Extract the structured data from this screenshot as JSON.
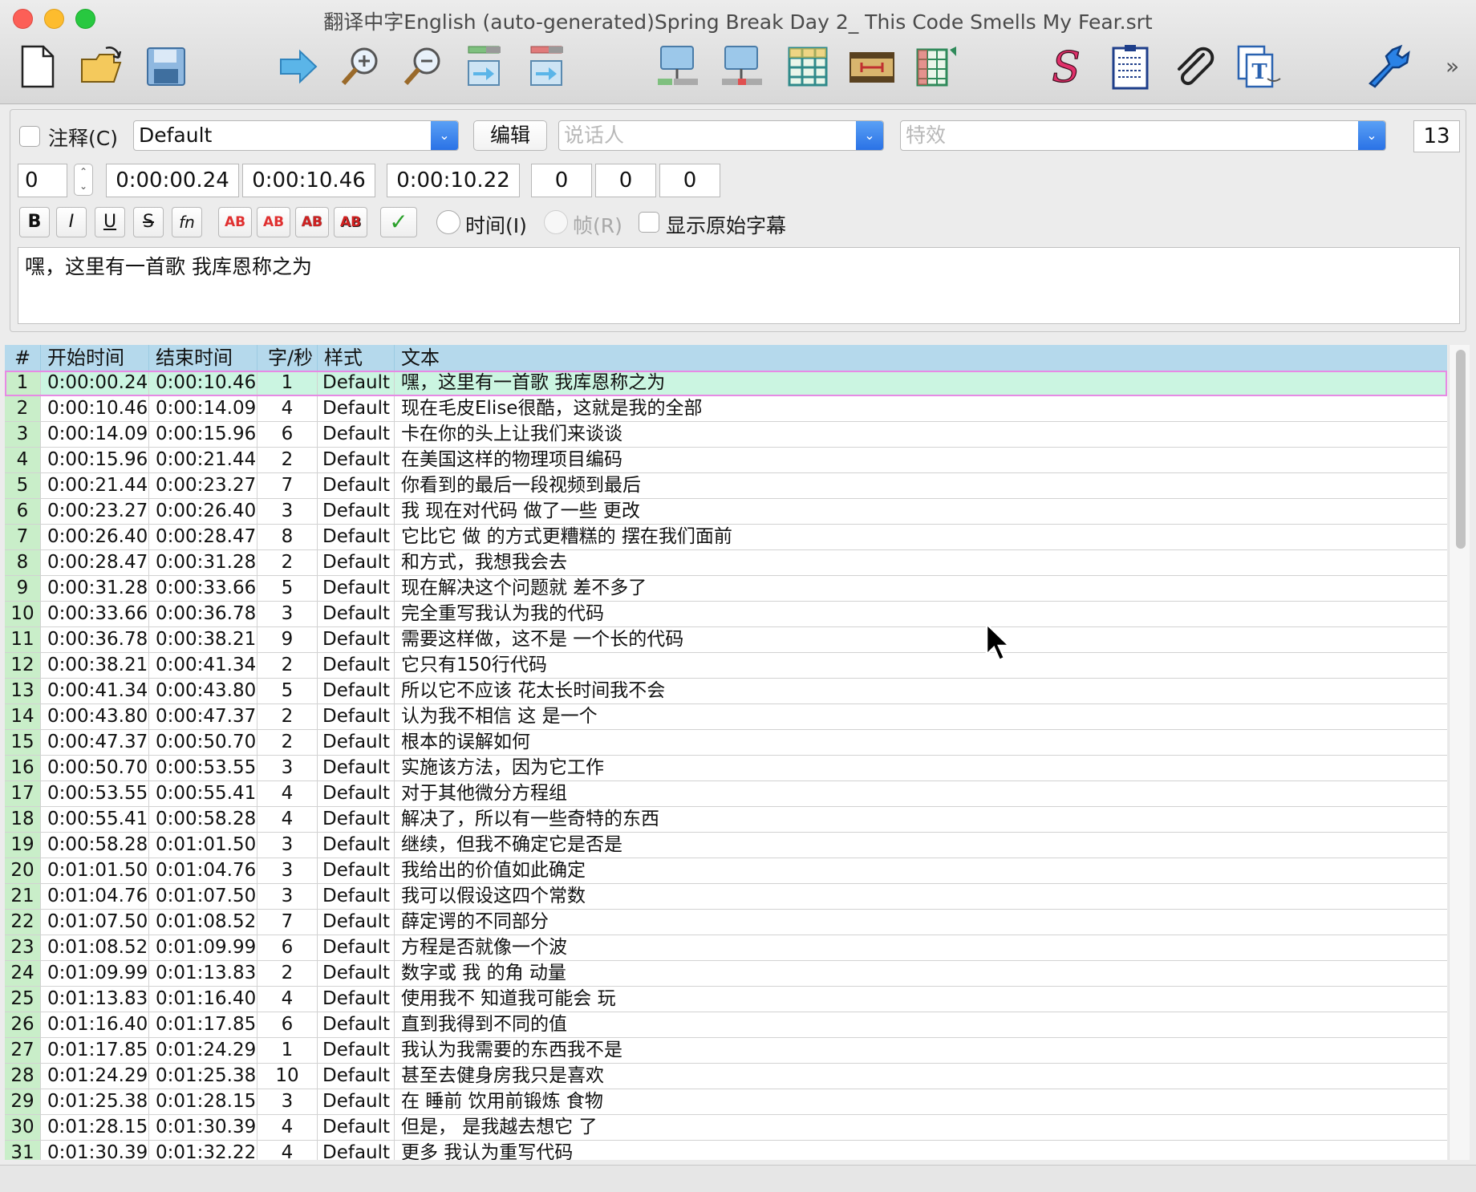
{
  "window": {
    "title": "翻译中字English (auto-generated)Spring Break Day 2_ This Code Smells My Fear.srt"
  },
  "toolbar": {
    "buttons": [
      {
        "name": "new-file"
      },
      {
        "name": "open-file"
      },
      {
        "name": "save"
      },
      {
        "name": "forward-arrow"
      },
      {
        "name": "zoom-in"
      },
      {
        "name": "zoom-out"
      },
      {
        "name": "move-down"
      },
      {
        "name": "move-up"
      },
      {
        "name": "insert-before"
      },
      {
        "name": "insert-after"
      },
      {
        "name": "table-view"
      },
      {
        "name": "film-strip"
      },
      {
        "name": "grid-edit"
      },
      {
        "name": "spell-check"
      },
      {
        "name": "clipboard"
      },
      {
        "name": "attachment"
      },
      {
        "name": "translate"
      },
      {
        "name": "settings-gear"
      }
    ],
    "more": "»"
  },
  "editor": {
    "comment_label": "注释(C)",
    "style_value": "Default",
    "edit_button": "编辑",
    "speaker_placeholder": "说话人",
    "effect_placeholder": "特效",
    "layer_value": "13",
    "line_index": "0",
    "start_time": "0:00:00.24",
    "end_time": "0:00:10.46",
    "duration": "0:00:10.22",
    "margin_l": "0",
    "margin_r": "0",
    "margin_v": "0",
    "format_buttons": [
      "B",
      "I",
      "U",
      "S",
      "fn",
      "AB",
      "AB",
      "AB",
      "AB",
      "✓"
    ],
    "time_radio": "时间(I)",
    "frame_radio": "帧(R)",
    "show_original": "显示原始字幕",
    "text": "嘿，这里有一首歌 我库恩称之为"
  },
  "grid": {
    "headers": [
      "#",
      "开始时间",
      "结束时间",
      "字/秒",
      "样式",
      "文本"
    ],
    "rows": [
      [
        "1",
        "0:00:00.24",
        "0:00:10.46",
        "1",
        "Default",
        "嘿，这里有一首歌 我库恩称之为"
      ],
      [
        "2",
        "0:00:10.46",
        "0:00:14.09",
        "4",
        "Default",
        "现在毛皮Elise很酷，这就是我的全部"
      ],
      [
        "3",
        "0:00:14.09",
        "0:00:15.96",
        "6",
        "Default",
        "卡在你的头上让我们来谈谈"
      ],
      [
        "4",
        "0:00:15.96",
        "0:00:21.44",
        "2",
        "Default",
        "在美国这样的物理项目编码"
      ],
      [
        "5",
        "0:00:21.44",
        "0:00:23.27",
        "7",
        "Default",
        "你看到的最后一段视频到最后"
      ],
      [
        "6",
        "0:00:23.27",
        "0:00:26.40",
        "3",
        "Default",
        "我 现在对代码 做了一些 更改"
      ],
      [
        "7",
        "0:00:26.40",
        "0:00:28.47",
        "8",
        "Default",
        "它比它 做 的方式更糟糕的 摆在我们面前"
      ],
      [
        "8",
        "0:00:28.47",
        "0:00:31.28",
        "2",
        "Default",
        "和方式，我想我会去"
      ],
      [
        "9",
        "0:00:31.28",
        "0:00:33.66",
        "5",
        "Default",
        "现在解决这个问题就 差不多了"
      ],
      [
        "10",
        "0:00:33.66",
        "0:00:36.78",
        "3",
        "Default",
        "完全重写我认为我的代码"
      ],
      [
        "11",
        "0:00:36.78",
        "0:00:38.21",
        "9",
        "Default",
        "需要这样做，这不是 一个长的代码"
      ],
      [
        "12",
        "0:00:38.21",
        "0:00:41.34",
        "2",
        "Default",
        "它只有150行代码"
      ],
      [
        "13",
        "0:00:41.34",
        "0:00:43.80",
        "5",
        "Default",
        "所以它不应该 花太长时间我不会"
      ],
      [
        "14",
        "0:00:43.80",
        "0:00:47.37",
        "2",
        "Default",
        "认为我不相信 这 是一个"
      ],
      [
        "15",
        "0:00:47.37",
        "0:00:50.70",
        "2",
        "Default",
        "根本的误解如何"
      ],
      [
        "16",
        "0:00:50.70",
        "0:00:53.55",
        "3",
        "Default",
        "实施该方法，因为它工作"
      ],
      [
        "17",
        "0:00:53.55",
        "0:00:55.41",
        "4",
        "Default",
        "对于其他微分方程组"
      ],
      [
        "18",
        "0:00:55.41",
        "0:00:58.28",
        "4",
        "Default",
        "解决了，所以有一些奇特的东西"
      ],
      [
        "19",
        "0:00:58.28",
        "0:01:01.50",
        "3",
        "Default",
        "继续，但我不确定它是否是"
      ],
      [
        "20",
        "0:01:01.50",
        "0:01:04.76",
        "3",
        "Default",
        "我给出的价值如此确定"
      ],
      [
        "21",
        "0:01:04.76",
        "0:01:07.50",
        "3",
        "Default",
        "我可以假设这四个常数"
      ],
      [
        "22",
        "0:01:07.50",
        "0:01:08.52",
        "7",
        "Default",
        "薛定谔的不同部分"
      ],
      [
        "23",
        "0:01:08.52",
        "0:01:09.99",
        "6",
        "Default",
        "方程是否就像一个波"
      ],
      [
        "24",
        "0:01:09.99",
        "0:01:13.83",
        "2",
        "Default",
        "数字或 我 的角 动量"
      ],
      [
        "25",
        "0:01:13.83",
        "0:01:16.40",
        "4",
        "Default",
        "使用我不 知道我可能会 玩"
      ],
      [
        "26",
        "0:01:16.40",
        "0:01:17.85",
        "6",
        "Default",
        "直到我得到不同的值"
      ],
      [
        "27",
        "0:01:17.85",
        "0:01:24.29",
        "1",
        "Default",
        "我认为我需要的东西我不是"
      ],
      [
        "28",
        "0:01:24.29",
        "0:01:25.38",
        "10",
        "Default",
        "甚至去健身房我只是喜欢"
      ],
      [
        "29",
        "0:01:25.38",
        "0:01:28.15",
        "3",
        "Default",
        "在 睡前 饮用前锻炼 食物"
      ],
      [
        "30",
        "0:01:28.15",
        "0:01:30.39",
        "4",
        "Default",
        "但是， 是我越去想它 了"
      ],
      [
        "31",
        "0:01:30.39",
        "0:01:32.22",
        "4",
        "Default",
        "更多 我认为重写代码"
      ]
    ],
    "selected_row": 1
  },
  "colors": {
    "header_bg": "#b5d9ec",
    "number_col_bg": "#c9eec9",
    "selected_row_bg": "#cbf5e1",
    "selected_row_border": "#e78ae4",
    "accent": "#2a72e6"
  }
}
